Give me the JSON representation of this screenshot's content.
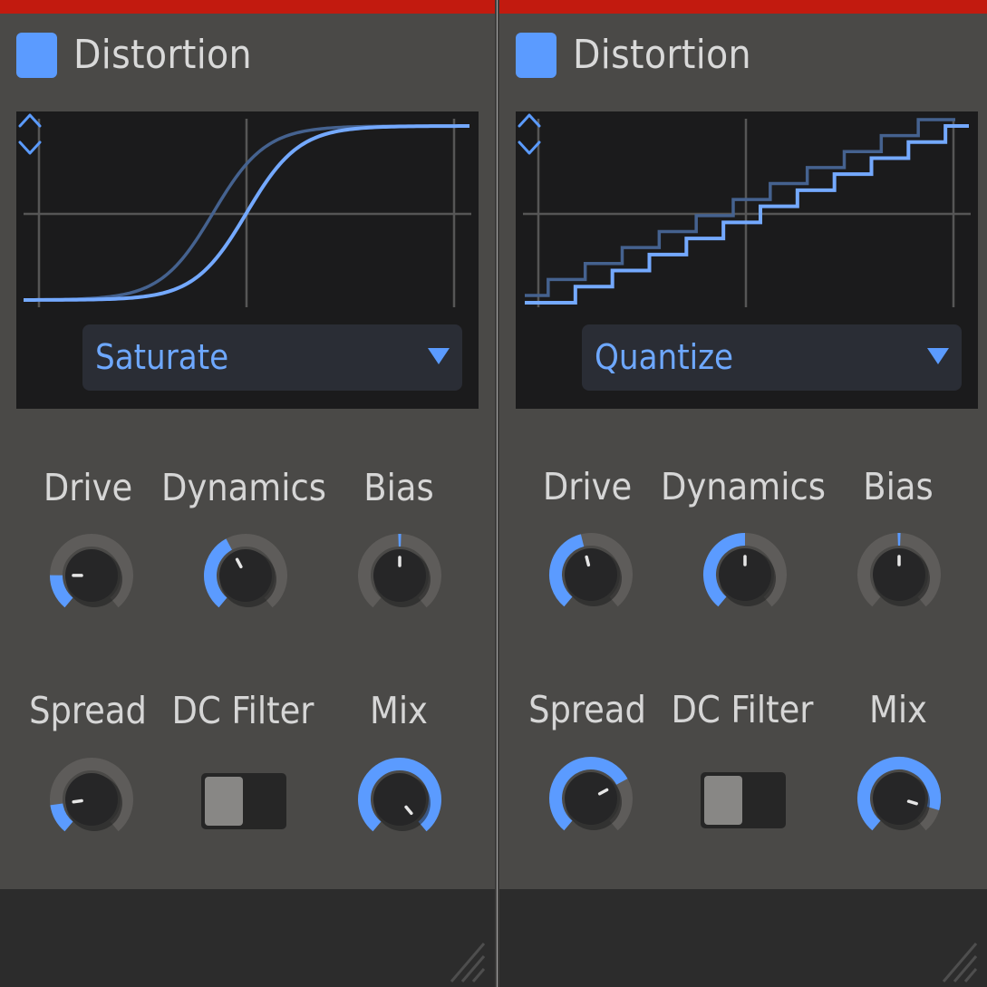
{
  "colors": {
    "accent": "#5b9bff",
    "curve_primary": "#74a9ff",
    "curve_secondary": "#45628f",
    "knob_track": "#5e5c5a",
    "knob_body": "#262627",
    "header_red": "#c21a0f"
  },
  "panels": [
    {
      "id": "left",
      "title": "Distortion",
      "mode": "Saturate",
      "curve_type": "saturate",
      "knobs": [
        {
          "id": "drive",
          "label": "Drive",
          "value": 0.18
        },
        {
          "id": "dynamics",
          "label": "Dynamics",
          "value": 0.4
        },
        {
          "id": "bias",
          "label": "Bias",
          "value": 0.5,
          "bipolar": true
        },
        {
          "id": "spread",
          "label": "Spread",
          "value": 0.15
        },
        {
          "id": "mix",
          "label": "Mix",
          "value": 1.0
        }
      ],
      "dc_filter": {
        "label": "DC Filter",
        "on": false
      }
    },
    {
      "id": "right",
      "title": "Distortion",
      "mode": "Quantize",
      "curve_type": "quantize",
      "knobs": [
        {
          "id": "drive",
          "label": "Drive",
          "value": 0.45
        },
        {
          "id": "dynamics",
          "label": "Dynamics",
          "value": 0.5
        },
        {
          "id": "bias",
          "label": "Bias",
          "value": 0.5,
          "bipolar": true
        },
        {
          "id": "spread",
          "label": "Spread",
          "value": 0.72
        },
        {
          "id": "mix",
          "label": "Mix",
          "value": 0.88
        }
      ],
      "dc_filter": {
        "label": "DC Filter",
        "on": false
      }
    }
  ]
}
